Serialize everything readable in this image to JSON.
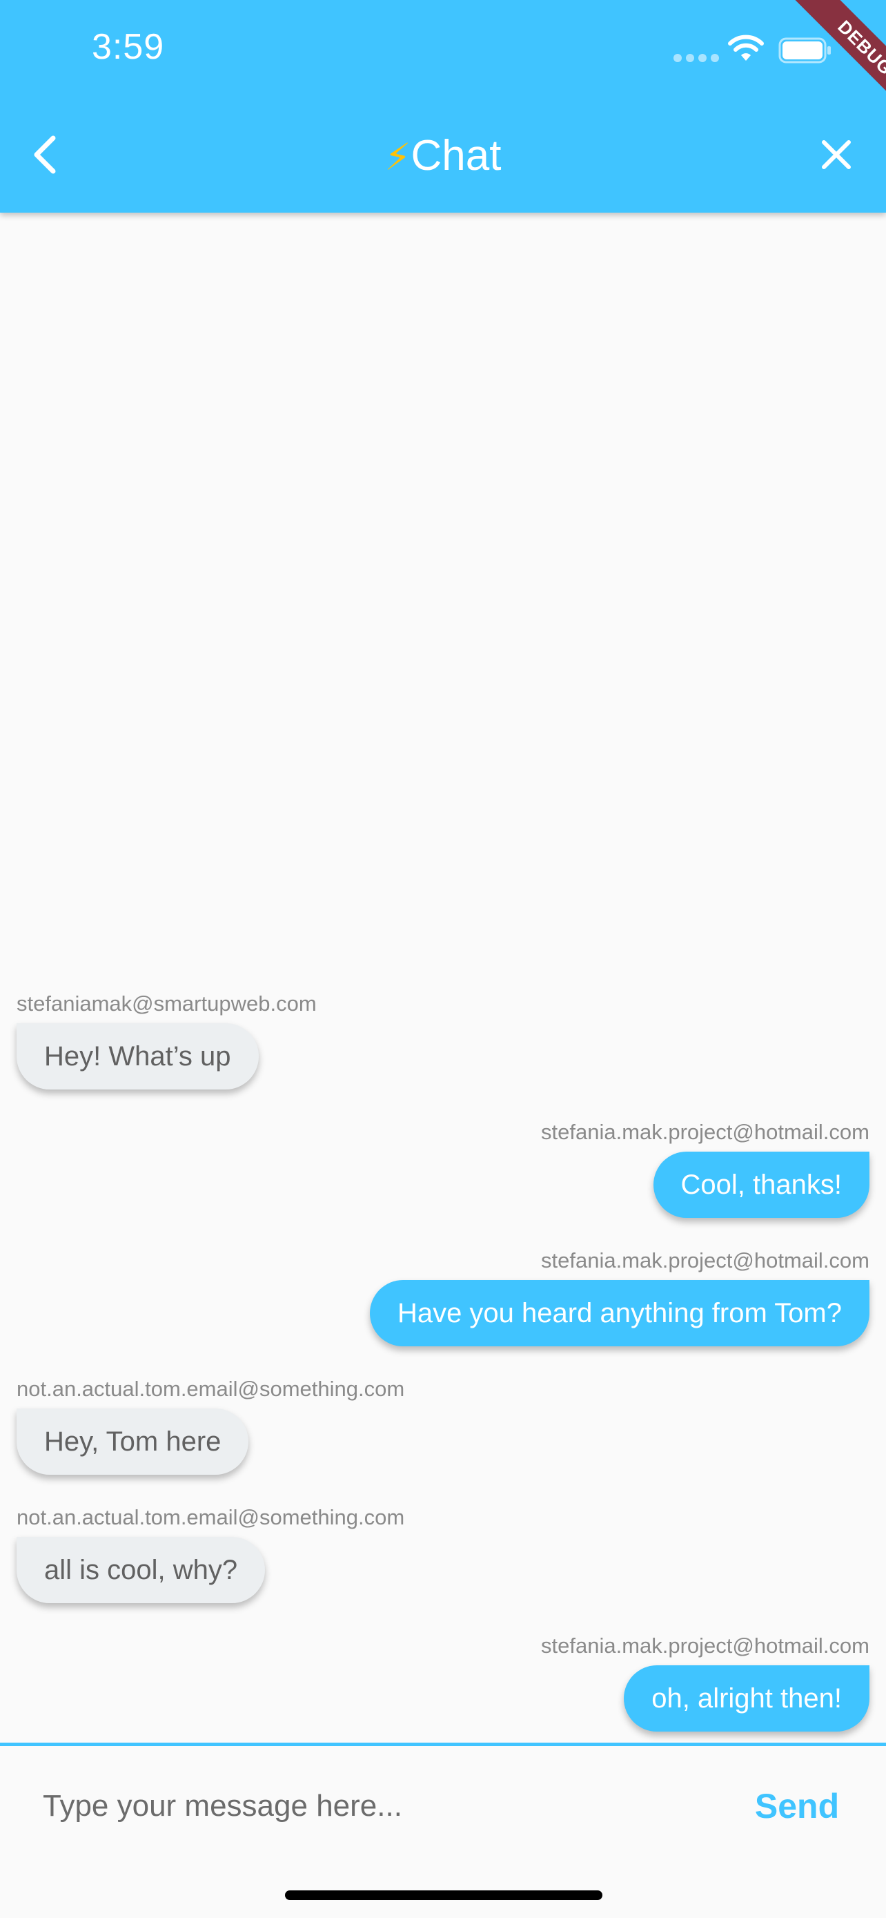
{
  "status_bar": {
    "time": "3:59"
  },
  "app_bar": {
    "title_icon": "⚡",
    "title": "Chat",
    "back_icon": "chevron-left-icon",
    "close_icon": "close-icon"
  },
  "debug_banner": {
    "label": "DEBUG"
  },
  "messages": [
    {
      "sender": "stefaniamak@smartupweb.com",
      "text": "Hey! What’s up",
      "direction": "incoming"
    },
    {
      "sender": "stefania.mak.project@hotmail.com",
      "text": "Cool, thanks!",
      "direction": "outgoing"
    },
    {
      "sender": "stefania.mak.project@hotmail.com",
      "text": "Have you heard anything from Tom?",
      "direction": "outgoing"
    },
    {
      "sender": "not.an.actual.tom.email@something.com",
      "text": "Hey, Tom here",
      "direction": "incoming"
    },
    {
      "sender": "not.an.actual.tom.email@something.com",
      "text": "all is cool, why?",
      "direction": "incoming"
    },
    {
      "sender": "stefania.mak.project@hotmail.com",
      "text": "oh, alright then!",
      "direction": "outgoing"
    }
  ],
  "composer": {
    "placeholder": "Type your message here...",
    "value": "",
    "send_label": "Send"
  },
  "colors": {
    "accent": "#40c4ff",
    "incoming_bubble": "#eceff1",
    "background": "#fafafa",
    "debug_banner": "#a00000"
  }
}
